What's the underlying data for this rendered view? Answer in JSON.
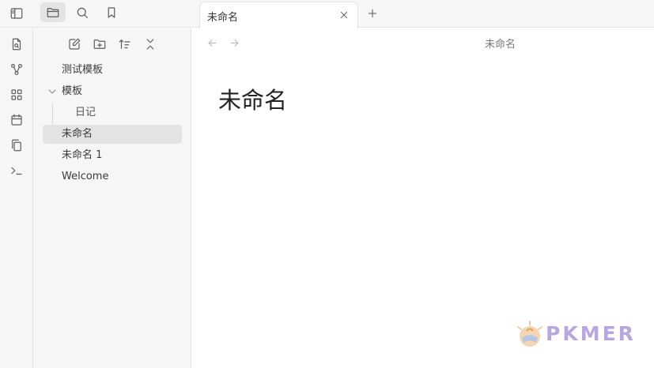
{
  "sidebar": {
    "top_icons": [
      "sidebar-toggle-icon",
      "folder-icon",
      "search-icon",
      "bookmark-icon"
    ],
    "ribbon_icons": [
      "file-search-icon",
      "graph-icon",
      "blocks-icon",
      "calendar-icon",
      "copy-icon",
      "terminal-icon"
    ],
    "toolbar_icons": [
      "new-note-icon",
      "new-folder-icon",
      "sort-icon",
      "collapse-icon"
    ],
    "files": [
      {
        "label": "测试模板"
      },
      {
        "label": "模板"
      },
      {
        "label": "日记"
      },
      {
        "label": "未命名"
      },
      {
        "label": "未命名 1"
      },
      {
        "label": "Welcome"
      }
    ]
  },
  "tabs": [
    {
      "label": "未命名"
    }
  ],
  "view": {
    "header_title": "未命名",
    "document_title": "未命名"
  },
  "watermark": {
    "text": "PKMER"
  }
}
